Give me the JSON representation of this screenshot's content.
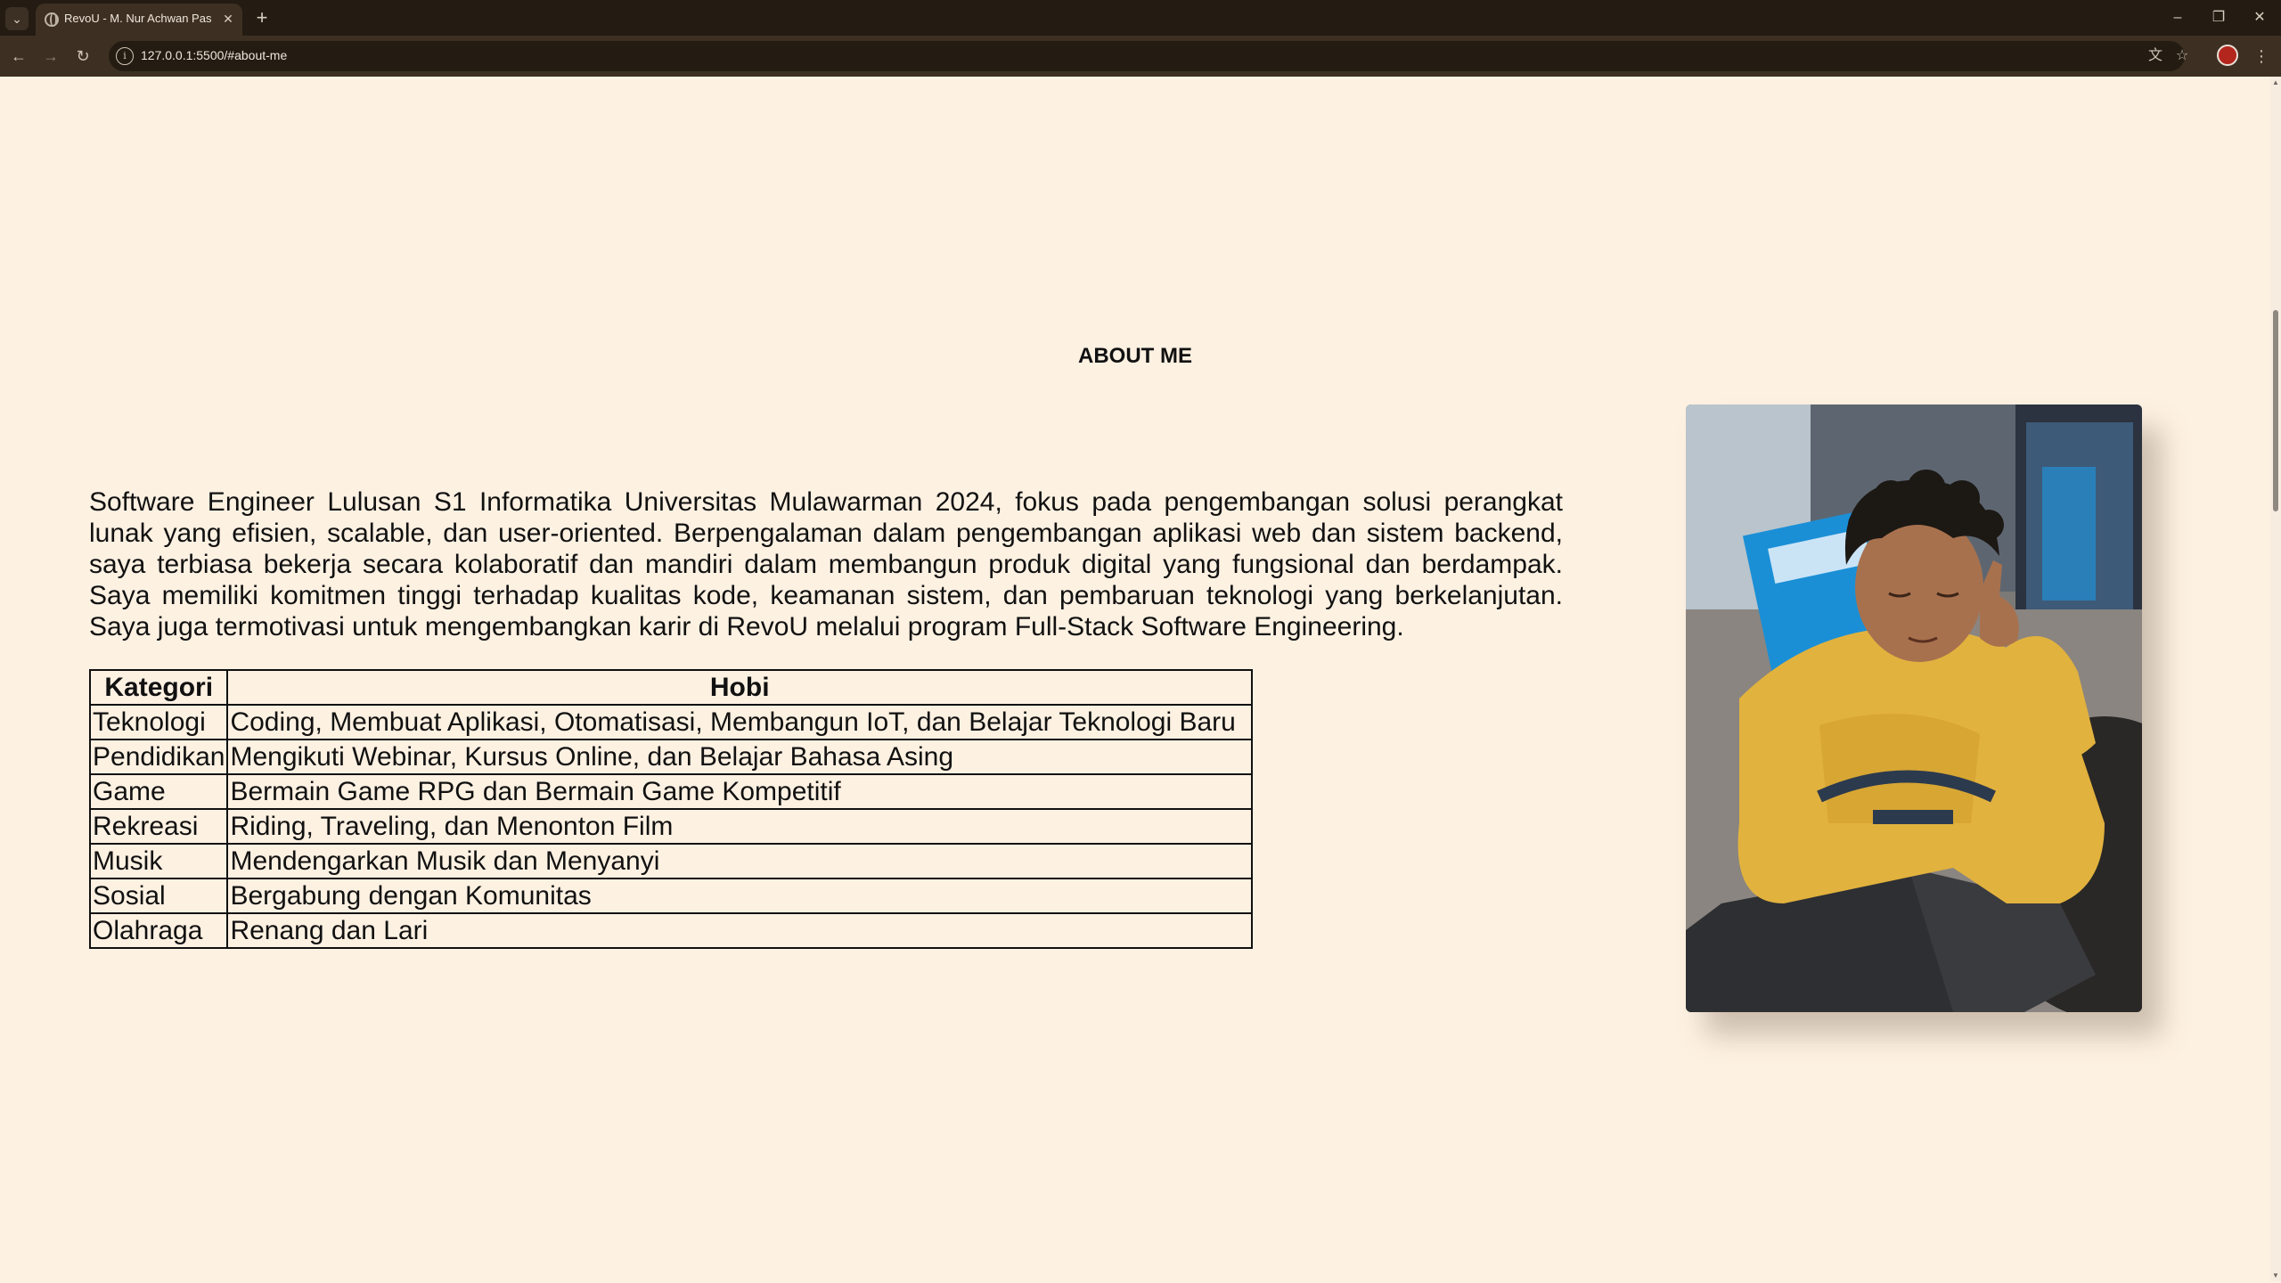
{
  "browser": {
    "tab_title": "RevoU - M. Nur Achwan Pasla",
    "url": "127.0.0.1:5500/#about-me",
    "new_tab_symbol": "+",
    "icons": [
      "tab-search-icon",
      "globe-icon",
      "close-icon",
      "plus-icon",
      "minimize-icon",
      "restore-icon",
      "close-window-icon",
      "back-arrow-icon",
      "forward-arrow-icon",
      "reload-icon",
      "site-info-icon",
      "translate-icon",
      "star-icon",
      "profile-avatar",
      "kebab-menu-icon"
    ]
  },
  "about": {
    "heading": "ABOUT ME",
    "bio": "Software Engineer Lulusan S1 Informatika Universitas Mulawarman 2024, fokus pada pengembangan solusi perangkat lunak yang efisien, scalable, dan user-oriented. Berpengalaman dalam pengembangan aplikasi web dan sistem backend, saya terbiasa bekerja secara kolaboratif dan mandiri dalam membangun produk digital yang fungsional dan berdampak. Saya memiliki komitmen tinggi terhadap kualitas kode, keamanan sistem, dan pembaruan teknologi yang berkelanjutan. Saya juga termotivasi untuk mengembangkan karir di RevoU melalui program Full-Stack Software Engineering."
  },
  "table": {
    "headers": [
      "Kategori",
      "Hobi"
    ],
    "rows": [
      {
        "kategori": "Teknologi",
        "hobi": "Coding, Membuat Aplikasi, Otomatisasi, Membangun IoT, dan Belajar Teknologi Baru"
      },
      {
        "kategori": "Pendidikan",
        "hobi": "Mengikuti Webinar, Kursus Online, dan Belajar Bahasa Asing"
      },
      {
        "kategori": "Game",
        "hobi": "Bermain Game RPG dan Bermain Game Kompetitif"
      },
      {
        "kategori": "Rekreasi",
        "hobi": "Riding, Traveling, dan Menonton Film"
      },
      {
        "kategori": "Musik",
        "hobi": "Mendengarkan Musik dan Menyanyi"
      },
      {
        "kategori": "Sosial",
        "hobi": "Bergabung dengan Komunitas"
      },
      {
        "kategori": "Olahraga",
        "hobi": "Renang dan Lari"
      }
    ]
  },
  "colors": {
    "page_background": "#fdf1e2",
    "chrome_dark": "#241c12",
    "chrome_toolbar": "#3d3022",
    "text": "#111111",
    "hoodie_yellow": "#e2b23e",
    "sign_blue": "#1b8fd6"
  }
}
